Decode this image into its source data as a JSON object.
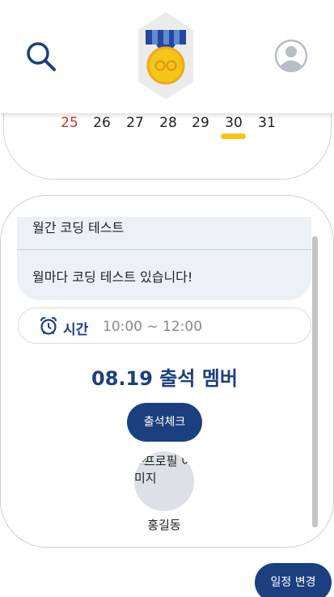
{
  "header": {
    "search_icon": "search-icon",
    "logo_icon": "medal-logo",
    "profile_icon": "profile-icon"
  },
  "calendar": {
    "days": [
      "25",
      "26",
      "27",
      "28",
      "29",
      "30",
      "31"
    ],
    "sunday_color": "#c0392b",
    "selected_day": "30",
    "indicator_color": "#f5c518"
  },
  "schedule": {
    "title": "월간 코딩 테스트",
    "description": "월마다 코딩 테스트 있습니다!",
    "time_label": "시간",
    "time_value": "10:00 ~ 12:00",
    "attendance_title": "08.19 출석 멤버",
    "check_button": "출석체크",
    "members": [
      {
        "avatar_alt": "프로필 이미지",
        "name": "홍길동"
      }
    ]
  },
  "footer": {
    "change_button": "일정 변경"
  },
  "colors": {
    "primary": "#1c3f7f",
    "box_bg": "#edf1f6",
    "medal_gold": "#f5c518"
  }
}
